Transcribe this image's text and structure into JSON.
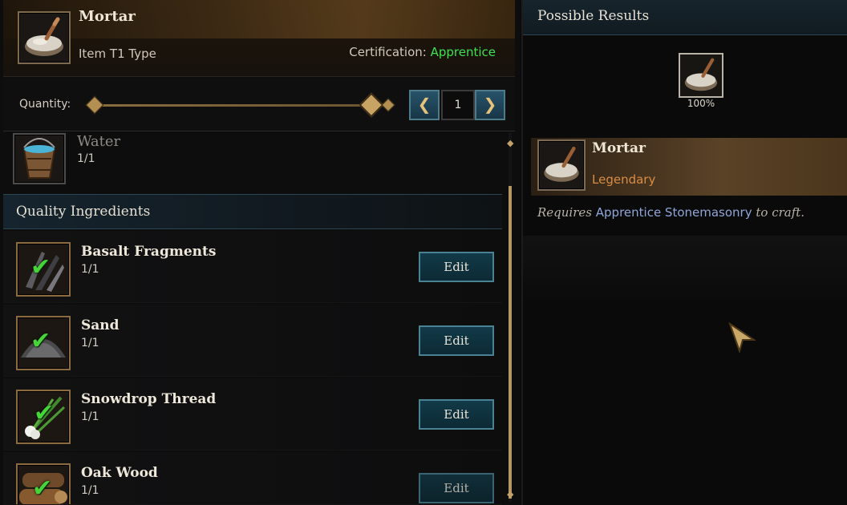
{
  "header": {
    "item_name": "Mortar",
    "item_type": "Item T1 Type",
    "certification_label": "Certification:",
    "certification_value": "Apprentice",
    "icon": "mortar-bowl-icon"
  },
  "quantity": {
    "label": "Quantity:",
    "value": "1",
    "decrease_icon": "chevron-left-icon",
    "increase_icon": "chevron-right-icon"
  },
  "required_ingredient": {
    "name": "Water",
    "count": "1/1",
    "icon": "water-bucket-icon"
  },
  "quality_section": {
    "title": "Quality Ingredients",
    "items": [
      {
        "name": "Basalt Fragments",
        "count": "1/1",
        "button": "Edit",
        "icon": "basalt-fragments-icon"
      },
      {
        "name": "Sand",
        "count": "1/1",
        "button": "Edit",
        "icon": "sand-pile-icon"
      },
      {
        "name": "Snowdrop Thread",
        "count": "1/1",
        "button": "Edit",
        "icon": "snowdrop-thread-icon"
      },
      {
        "name": "Oak Wood",
        "count": "1/1",
        "button": "Edit",
        "icon": "oak-wood-icon"
      }
    ]
  },
  "results": {
    "title": "Possible Results",
    "chance": "100%",
    "result_name": "Mortar",
    "rarity": "Legendary",
    "requires_prefix": "Requires",
    "requires_skill": "Apprentice Stonemasonry",
    "requires_suffix": "to craft."
  },
  "colors": {
    "certification": "#3ee24b",
    "legendary": "#d98d44",
    "skill_link": "#8fa6d8",
    "check": "#47d43a"
  }
}
